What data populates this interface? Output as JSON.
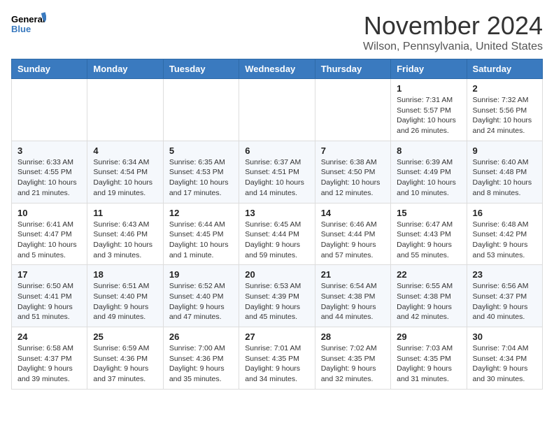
{
  "header": {
    "logo_line1": "General",
    "logo_line2": "Blue",
    "title": "November 2024",
    "subtitle": "Wilson, Pennsylvania, United States"
  },
  "weekdays": [
    "Sunday",
    "Monday",
    "Tuesday",
    "Wednesday",
    "Thursday",
    "Friday",
    "Saturday"
  ],
  "weeks": [
    [
      {
        "day": "",
        "info": ""
      },
      {
        "day": "",
        "info": ""
      },
      {
        "day": "",
        "info": ""
      },
      {
        "day": "",
        "info": ""
      },
      {
        "day": "",
        "info": ""
      },
      {
        "day": "1",
        "info": "Sunrise: 7:31 AM\nSunset: 5:57 PM\nDaylight: 10 hours and 26 minutes."
      },
      {
        "day": "2",
        "info": "Sunrise: 7:32 AM\nSunset: 5:56 PM\nDaylight: 10 hours and 24 minutes."
      }
    ],
    [
      {
        "day": "3",
        "info": "Sunrise: 6:33 AM\nSunset: 4:55 PM\nDaylight: 10 hours and 21 minutes."
      },
      {
        "day": "4",
        "info": "Sunrise: 6:34 AM\nSunset: 4:54 PM\nDaylight: 10 hours and 19 minutes."
      },
      {
        "day": "5",
        "info": "Sunrise: 6:35 AM\nSunset: 4:53 PM\nDaylight: 10 hours and 17 minutes."
      },
      {
        "day": "6",
        "info": "Sunrise: 6:37 AM\nSunset: 4:51 PM\nDaylight: 10 hours and 14 minutes."
      },
      {
        "day": "7",
        "info": "Sunrise: 6:38 AM\nSunset: 4:50 PM\nDaylight: 10 hours and 12 minutes."
      },
      {
        "day": "8",
        "info": "Sunrise: 6:39 AM\nSunset: 4:49 PM\nDaylight: 10 hours and 10 minutes."
      },
      {
        "day": "9",
        "info": "Sunrise: 6:40 AM\nSunset: 4:48 PM\nDaylight: 10 hours and 8 minutes."
      }
    ],
    [
      {
        "day": "10",
        "info": "Sunrise: 6:41 AM\nSunset: 4:47 PM\nDaylight: 10 hours and 5 minutes."
      },
      {
        "day": "11",
        "info": "Sunrise: 6:43 AM\nSunset: 4:46 PM\nDaylight: 10 hours and 3 minutes."
      },
      {
        "day": "12",
        "info": "Sunrise: 6:44 AM\nSunset: 4:45 PM\nDaylight: 10 hours and 1 minute."
      },
      {
        "day": "13",
        "info": "Sunrise: 6:45 AM\nSunset: 4:44 PM\nDaylight: 9 hours and 59 minutes."
      },
      {
        "day": "14",
        "info": "Sunrise: 6:46 AM\nSunset: 4:44 PM\nDaylight: 9 hours and 57 minutes."
      },
      {
        "day": "15",
        "info": "Sunrise: 6:47 AM\nSunset: 4:43 PM\nDaylight: 9 hours and 55 minutes."
      },
      {
        "day": "16",
        "info": "Sunrise: 6:48 AM\nSunset: 4:42 PM\nDaylight: 9 hours and 53 minutes."
      }
    ],
    [
      {
        "day": "17",
        "info": "Sunrise: 6:50 AM\nSunset: 4:41 PM\nDaylight: 9 hours and 51 minutes."
      },
      {
        "day": "18",
        "info": "Sunrise: 6:51 AM\nSunset: 4:40 PM\nDaylight: 9 hours and 49 minutes."
      },
      {
        "day": "19",
        "info": "Sunrise: 6:52 AM\nSunset: 4:40 PM\nDaylight: 9 hours and 47 minutes."
      },
      {
        "day": "20",
        "info": "Sunrise: 6:53 AM\nSunset: 4:39 PM\nDaylight: 9 hours and 45 minutes."
      },
      {
        "day": "21",
        "info": "Sunrise: 6:54 AM\nSunset: 4:38 PM\nDaylight: 9 hours and 44 minutes."
      },
      {
        "day": "22",
        "info": "Sunrise: 6:55 AM\nSunset: 4:38 PM\nDaylight: 9 hours and 42 minutes."
      },
      {
        "day": "23",
        "info": "Sunrise: 6:56 AM\nSunset: 4:37 PM\nDaylight: 9 hours and 40 minutes."
      }
    ],
    [
      {
        "day": "24",
        "info": "Sunrise: 6:58 AM\nSunset: 4:37 PM\nDaylight: 9 hours and 39 minutes."
      },
      {
        "day": "25",
        "info": "Sunrise: 6:59 AM\nSunset: 4:36 PM\nDaylight: 9 hours and 37 minutes."
      },
      {
        "day": "26",
        "info": "Sunrise: 7:00 AM\nSunset: 4:36 PM\nDaylight: 9 hours and 35 minutes."
      },
      {
        "day": "27",
        "info": "Sunrise: 7:01 AM\nSunset: 4:35 PM\nDaylight: 9 hours and 34 minutes."
      },
      {
        "day": "28",
        "info": "Sunrise: 7:02 AM\nSunset: 4:35 PM\nDaylight: 9 hours and 32 minutes."
      },
      {
        "day": "29",
        "info": "Sunrise: 7:03 AM\nSunset: 4:35 PM\nDaylight: 9 hours and 31 minutes."
      },
      {
        "day": "30",
        "info": "Sunrise: 7:04 AM\nSunset: 4:34 PM\nDaylight: 9 hours and 30 minutes."
      }
    ]
  ]
}
